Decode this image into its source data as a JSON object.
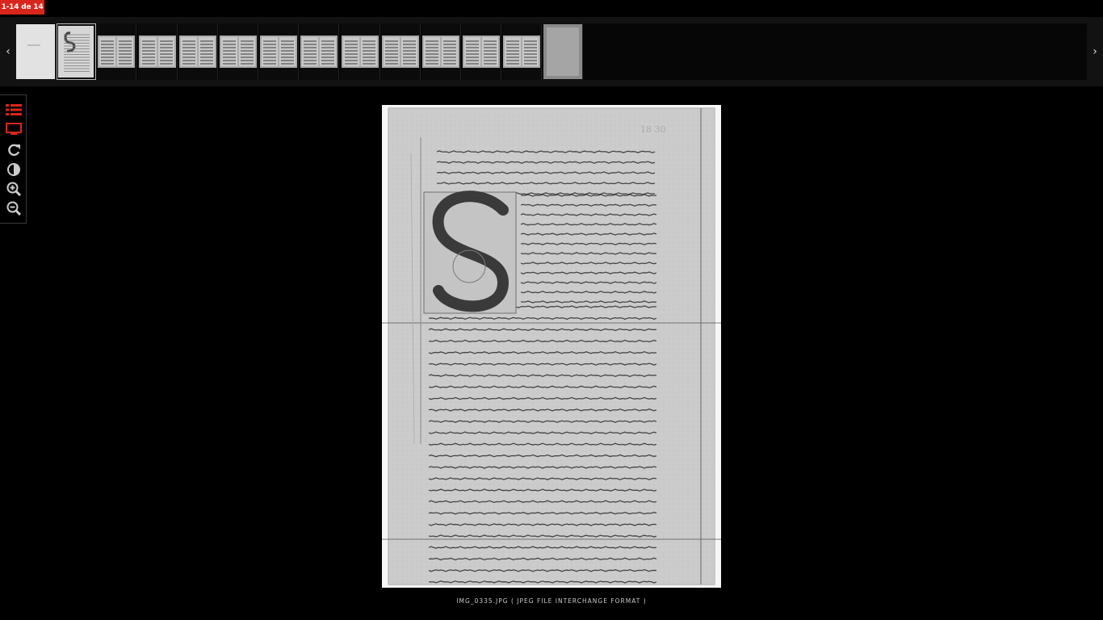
{
  "counter": "1-14 de 14",
  "thumbnails": [
    {
      "kind": "cover",
      "active": false
    },
    {
      "kind": "page",
      "active": true
    },
    {
      "kind": "spread",
      "active": false
    },
    {
      "kind": "spread",
      "active": false
    },
    {
      "kind": "spread",
      "active": false
    },
    {
      "kind": "spread",
      "active": false
    },
    {
      "kind": "spread",
      "active": false
    },
    {
      "kind": "spread",
      "active": false
    },
    {
      "kind": "spread",
      "active": false
    },
    {
      "kind": "spread",
      "active": false
    },
    {
      "kind": "spread",
      "active": false
    },
    {
      "kind": "spread",
      "active": false
    },
    {
      "kind": "spread",
      "active": false
    },
    {
      "kind": "page-dark",
      "active": false
    }
  ],
  "toolbar": [
    {
      "name": "list-icon",
      "color": "#d9261c"
    },
    {
      "name": "monitor-icon",
      "color": "#d9261c"
    },
    {
      "name": "rotate-icon",
      "color": "#cccccc"
    },
    {
      "name": "contrast-icon",
      "color": "#cccccc"
    },
    {
      "name": "zoom-in-icon",
      "color": "#cccccc"
    },
    {
      "name": "zoom-out-icon",
      "color": "#cccccc"
    }
  ],
  "image": {
    "folio": "18 30"
  },
  "caption": "IMG_0335.JPG ( JPEG FILE INTERCHANGE FORMAT )",
  "colors": {
    "accent": "#d9261c",
    "background": "#000000"
  }
}
